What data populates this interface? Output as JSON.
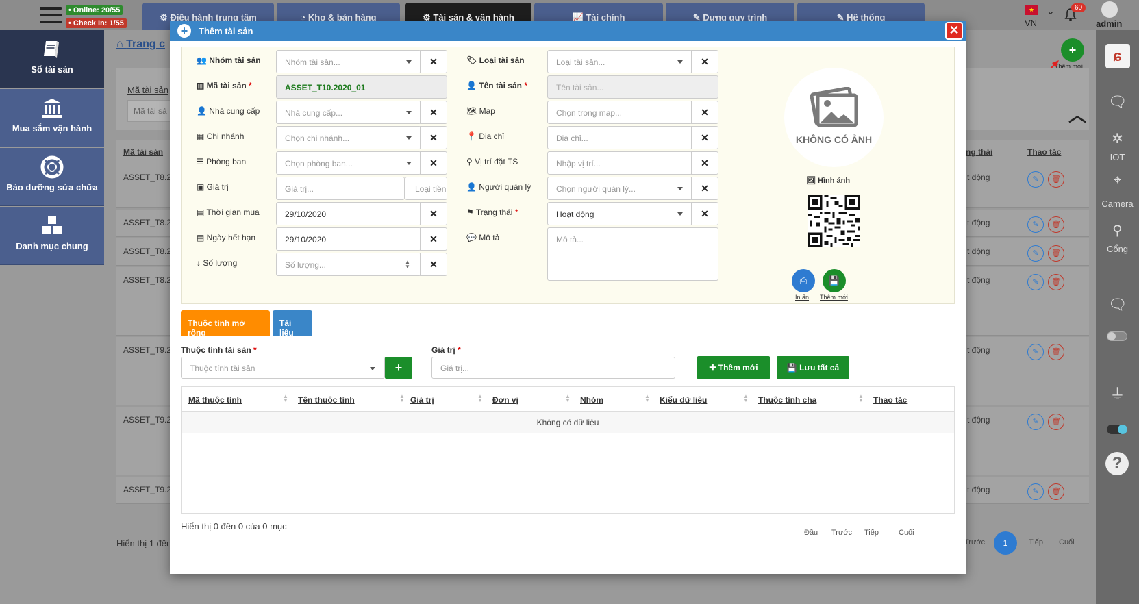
{
  "topbar": {
    "online": "• Online: 20/55",
    "checkin": "• Check In: 1/55",
    "tabs": [
      {
        "label": "⚙ Điều hành trung tâm"
      },
      {
        "label": "◔ Kho & bán hàng"
      },
      {
        "label": "⚙ Tài sản & vận hành"
      },
      {
        "label": "📈 Tài chính"
      },
      {
        "label": "✎ Dựng quy trình"
      },
      {
        "label": "✎ Hệ thống"
      }
    ],
    "lang": "VN",
    "notif_count": "60",
    "user": "admin"
  },
  "leftnav": {
    "items": [
      {
        "label": "Sổ tài sản"
      },
      {
        "label": "Mua sắm vận hành"
      },
      {
        "label": "Bảo dưỡng sửa chữa"
      },
      {
        "label": "Danh mục chung"
      }
    ]
  },
  "rightnav": {
    "iot": "IOT",
    "camera": "Camera",
    "gate": "Cổng"
  },
  "background": {
    "breadcrumb": "Trang c",
    "add_label": "Thêm mới",
    "filter_label": "Mã tài sản",
    "filter_placeholder": "Mã tài sả",
    "col_code": "Mã tài sản",
    "col_status": "ng thái",
    "col_action": "Thao tác",
    "rows": [
      {
        "code": "ASSET_T8.20",
        "status": "t động"
      },
      {
        "code": "ASSET_T8.20",
        "status": "t động"
      },
      {
        "code": "ASSET_T8.20",
        "status": "t động"
      },
      {
        "code": "ASSET_T8.20",
        "status": "t động"
      },
      {
        "code": "ASSET_T9.20",
        "status": "t động"
      },
      {
        "code": "ASSET_T9.20",
        "status": "t động"
      },
      {
        "code": "ASSET_T9.20",
        "status": "t động"
      }
    ],
    "footer": "Hiển thị 1 đến",
    "pager": {
      "prev": "Trước",
      "page": "1",
      "next": "Tiếp",
      "last": "Cuối"
    }
  },
  "modal": {
    "title": "Thêm tài sản",
    "left": {
      "group_label": "Nhóm tài sản",
      "group_placeholder": "Nhóm tài sản...",
      "code_label": "Mã tài sản",
      "code_value": "ASSET_T10.2020_01",
      "supplier_label": "Nhà cung cấp",
      "supplier_placeholder": "Nhà cung cấp...",
      "branch_label": "Chi nhánh",
      "branch_placeholder": "Chọn chi nhánh...",
      "dept_label": "Phòng ban",
      "dept_placeholder": "Chọn phòng ban...",
      "value_label": "Giá trị",
      "value_placeholder": "Giá trị...",
      "value_type_placeholder": "Loại tiền",
      "buy_label": "Thời gian mua",
      "buy_value": "29/10/2020",
      "expire_label": "Ngày hết hạn",
      "expire_value": "29/10/2020",
      "qty_label": "Số lượng",
      "qty_placeholder": "Số lượng..."
    },
    "right": {
      "type_label": "Loại tài sản",
      "type_placeholder": "Loại tài sản...",
      "name_label": "Tên tài sản",
      "name_placeholder": "Tên tài sản...",
      "map_label": "Map",
      "map_placeholder": "Chọn trong map...",
      "addr_label": "Địa chỉ",
      "addr_placeholder": "Địa chỉ...",
      "loc_label": "Vị trí đặt TS",
      "loc_placeholder": "Nhập vị trí...",
      "mgr_label": "Người quản lý",
      "mgr_placeholder": "Chọn người quản lý...",
      "status_label": "Trạng thái",
      "status_value": "Hoạt động",
      "desc_label": "Mô tả",
      "desc_placeholder": "Mô tả..."
    },
    "image": {
      "no_image": "KHÔNG CÓ ẢNH",
      "image_label": "Hình ảnh",
      "print_label": "In ấn",
      "new_label": "Thêm mới"
    },
    "tabs": {
      "ext": "Thuộc tính mở rộng",
      "docs": "Tài liệu"
    },
    "attr": {
      "attr_label": "Thuộc tính tài sản",
      "attr_placeholder": "Thuộc tính tài sản",
      "val_label": "Giá trị",
      "val_placeholder": "Giá trị...",
      "add_btn": "Thêm mới",
      "save_btn": "Lưu tất cả"
    },
    "table": {
      "headers": [
        "Mã thuộc tính",
        "Tên thuộc tính",
        "Giá trị",
        "Đơn vị",
        "Nhóm",
        "Kiểu dữ liệu",
        "Thuộc tính cha",
        "Thao tác"
      ],
      "empty": "Không có dữ liệu"
    },
    "footer": {
      "info": "Hiển thị 0 đến 0 của 0 mục",
      "first": "Đầu",
      "prev": "Trước",
      "next": "Tiếp",
      "last": "Cuối"
    }
  }
}
